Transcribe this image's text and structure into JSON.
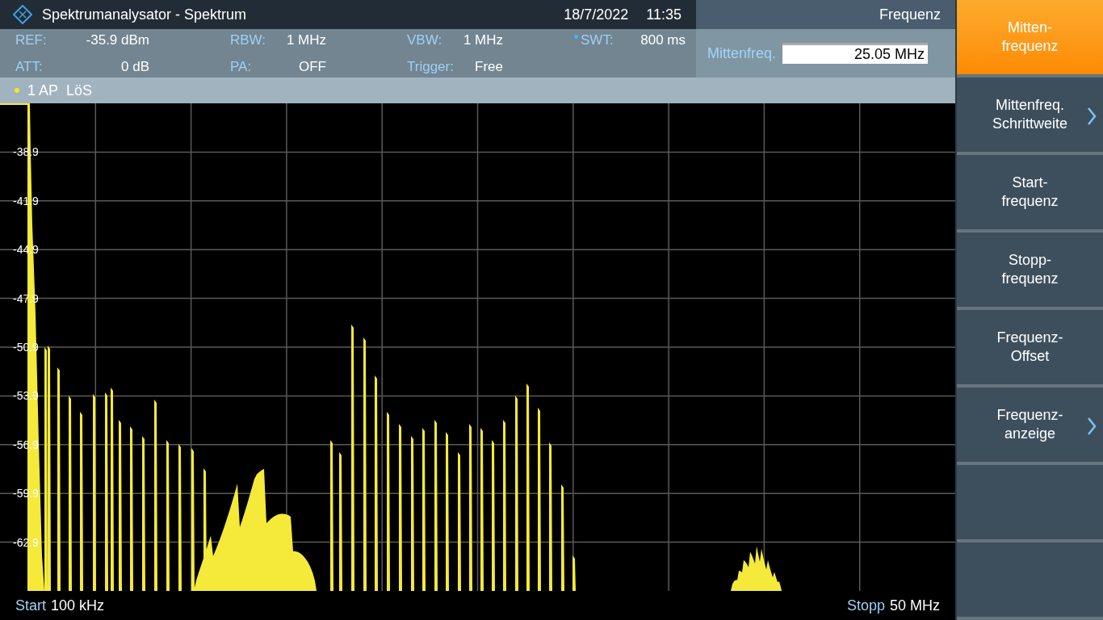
{
  "title_bar": {
    "title": "Spektrumanalysator - Spektrum",
    "date": "18/7/2022",
    "time": "11:35"
  },
  "menu_title": "Frequenz",
  "settings": [
    {
      "label": "REF:",
      "value": "-35.9 dBm",
      "dot": false
    },
    {
      "label": "ATT:",
      "value": "0 dB",
      "dot": false
    },
    {
      "label": "RBW:",
      "value": "1 MHz",
      "dot": false
    },
    {
      "label": "PA:",
      "value": "OFF",
      "dot": false
    },
    {
      "label": "VBW:",
      "value": "1 MHz",
      "dot": false
    },
    {
      "label": "Trigger:",
      "value": "Free",
      "dot": false
    },
    {
      "label": "SWT:",
      "value": "800 ms",
      "dot": true
    }
  ],
  "input": {
    "label": "Mittenfreq.",
    "value": "25.05 MHz"
  },
  "trace": {
    "label": "1 AP",
    "mode": "LöS"
  },
  "y_labels": [
    "-38.9",
    "-41.9",
    "-44.9",
    "-47.9",
    "-50.9",
    "-53.9",
    "-56.9",
    "-59.9",
    "-62.9"
  ],
  "start": {
    "label": "Start",
    "value": "100 kHz"
  },
  "stop": {
    "label": "Stopp",
    "value": "50 MHz"
  },
  "softkeys": [
    {
      "lines": [
        "Mitten-",
        "frequenz"
      ],
      "selected": true,
      "submenu": false
    },
    {
      "lines": [
        "Mittenfreq.",
        "Schrittweite"
      ],
      "selected": false,
      "submenu": true
    },
    {
      "lines": [
        "Start-",
        "frequenz"
      ],
      "selected": false,
      "submenu": false
    },
    {
      "lines": [
        "Stopp-",
        "frequenz"
      ],
      "selected": false,
      "submenu": false
    },
    {
      "lines": [
        "Frequenz-",
        "Offset"
      ],
      "selected": false,
      "submenu": false
    },
    {
      "lines": [
        "Frequenz-",
        "anzeige"
      ],
      "selected": false,
      "submenu": true
    },
    {
      "selected": false,
      "submenu": false
    },
    {
      "selected": false,
      "submenu": false
    }
  ]
}
